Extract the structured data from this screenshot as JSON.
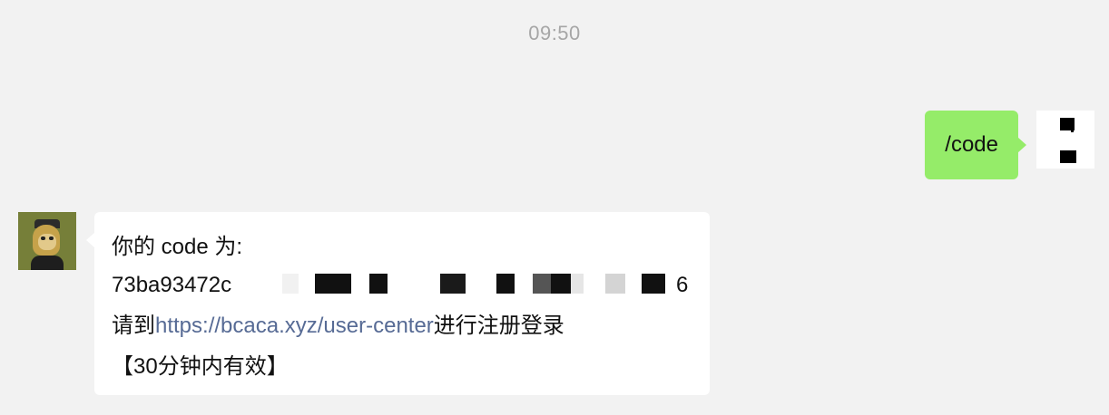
{
  "timestamp": "09:50",
  "outgoing": {
    "text": "/code"
  },
  "incoming": {
    "line1": "你的 code 为:",
    "code_prefix": "73ba93472c",
    "code_suffix": "6",
    "line3_before": "请到",
    "link": "https://bcaca.xyz/user-center",
    "line3_after": "进行注册登录",
    "line4": "【30分钟内有效】"
  },
  "colors": {
    "background": "#f2f2f2",
    "outgoing_bubble": "#95ec69",
    "incoming_bubble": "#ffffff",
    "link": "#576b95",
    "timestamp": "#a6a6a6"
  }
}
